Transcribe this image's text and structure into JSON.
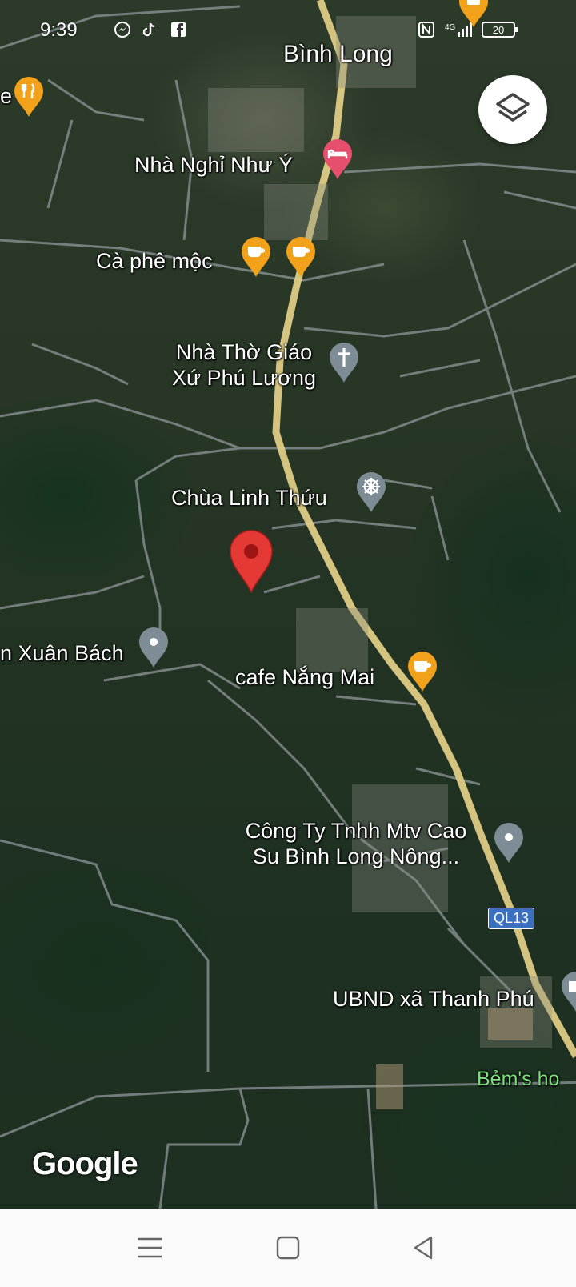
{
  "status_bar": {
    "time": "9:39",
    "icons": [
      "messenger-icon",
      "tiktok-icon",
      "facebook-icon",
      "nfc-icon",
      "signal-4g-icon",
      "battery-icon"
    ],
    "network": "4G",
    "battery": "20"
  },
  "map": {
    "labels": {
      "binh_long": "Bình Long",
      "nha_nghi": "Nhà Nghỉ Như Ý",
      "ca_phe_moc": "Cà phê mộc",
      "nha_tho_1": "Nhà Thờ Giáo",
      "nha_tho_2": "Xứ Phú Lương",
      "chua": "Chùa Linh Thứu",
      "xuan_bach": "n Xuân Bách",
      "cafe_nang_mai": "cafe Nắng Mai",
      "cong_ty_1": "Công Ty Tnhh Mtv Cao",
      "cong_ty_2": "Su Bình Long Nông...",
      "ubnd": "UBND xã Thanh Phú",
      "bem": "Bẻm's ho",
      "road_shield": "QL13",
      "google": "Google"
    },
    "colors": {
      "food_pin": "#f2a21a",
      "hotel_pin": "#e6506e",
      "place_pin": "#7d8c95",
      "selected_pin": "#e53935",
      "highway": "#e8d48a",
      "road": "#9aa3a6"
    }
  },
  "navbar": {
    "icons": [
      "menu-icon",
      "home-square-icon",
      "back-triangle-icon"
    ]
  }
}
